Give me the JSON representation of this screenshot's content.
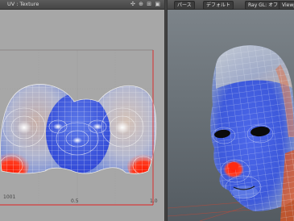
{
  "uv_editor": {
    "title": "UV : Texture",
    "toolbar_icons": [
      "✣",
      "⊕",
      "⊞",
      "▣"
    ],
    "corner_label": "1001",
    "axis_label_mid": "0.5",
    "axis_label_end": "1.0"
  },
  "viewport": {
    "buttons": [
      "パース",
      "デフォルト",
      "Ray GL: オフ",
      "Viewpo"
    ]
  },
  "colors": {
    "uv_background": "#a7a7a7",
    "viewport_background": "#6b7379",
    "uv_border_red": "#e02020",
    "mesh_blue": "#3f5be0",
    "mesh_red": "#ff2a10"
  }
}
